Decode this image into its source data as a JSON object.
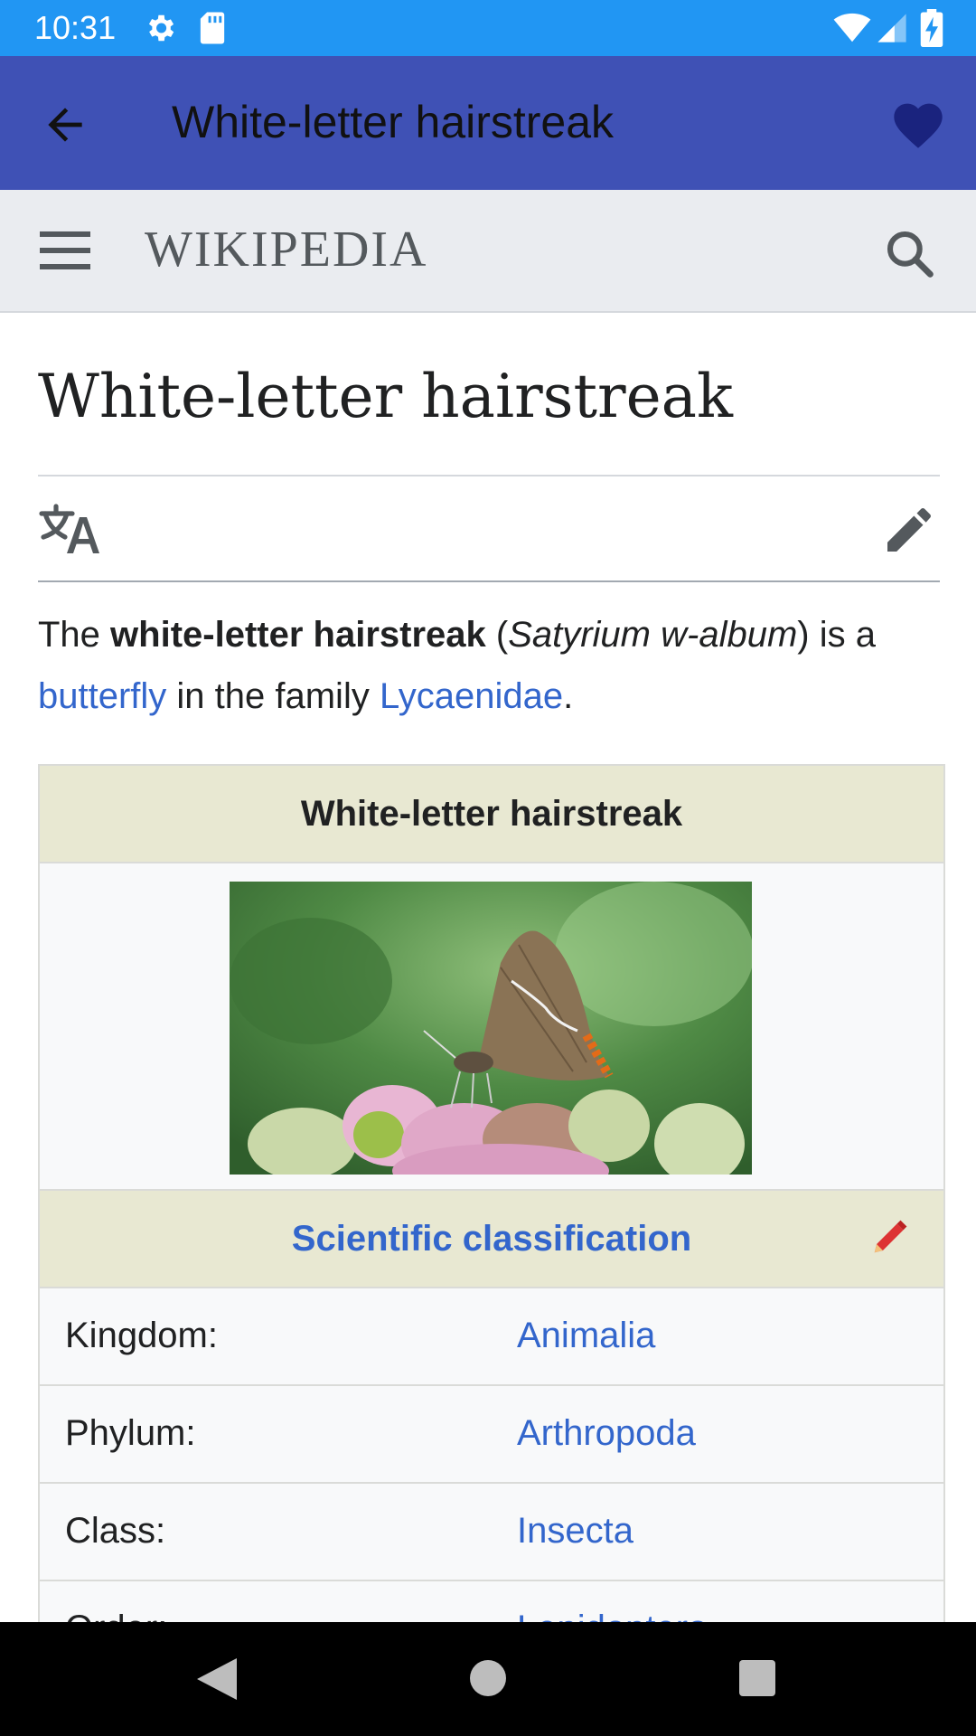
{
  "status_bar": {
    "time": "10:31",
    "icons": [
      "gear-icon",
      "sd-card-icon",
      "wifi-icon",
      "signal-icon",
      "battery-charging-icon"
    ],
    "background": "#2196f3"
  },
  "app_bar": {
    "title": "White-letter hairstreak",
    "background": "#3f51b5",
    "back_icon": "arrow-back-icon",
    "favorite_icon": "heart-icon"
  },
  "wiki_header": {
    "wordmark": "WIKIPEDIA",
    "menu_icon": "menu-icon",
    "search_icon": "search-icon"
  },
  "article": {
    "title": "White-letter hairstreak",
    "language_icon": "translate-icon",
    "edit_icon": "edit-pencil-icon",
    "lead": {
      "t1": "The ",
      "bold": "white-letter hairstreak",
      "t2": " (",
      "italic": "Satyrium w-album",
      "t3": ") is a ",
      "link1": "butterfly",
      "t4": " in the family ",
      "link2": "Lycaenidae",
      "t5": "."
    }
  },
  "infobox": {
    "header": "White-letter hairstreak",
    "classification_header": "Scientific classification",
    "rows": [
      {
        "key": "Kingdom:",
        "value": "Animalia"
      },
      {
        "key": "Phylum:",
        "value": "Arthropoda"
      },
      {
        "key": "Class:",
        "value": "Insecta"
      },
      {
        "key": "Order:",
        "value": "Lepidoptera"
      }
    ],
    "link_color": "#3366cc",
    "header_bg": "#e8e8d2"
  },
  "nav_bar": {
    "icons": [
      "nav-back-icon",
      "nav-home-icon",
      "nav-recents-icon"
    ]
  }
}
